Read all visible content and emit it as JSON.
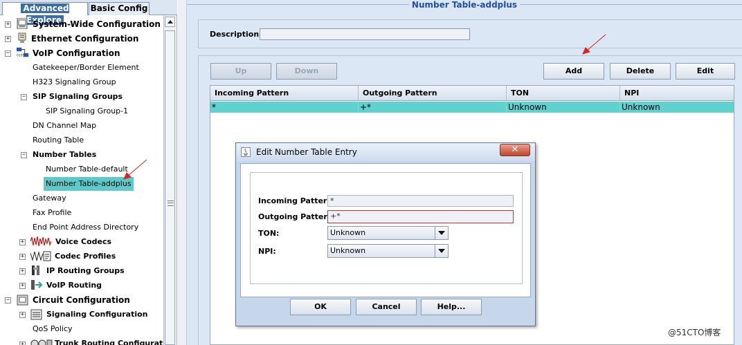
{
  "tabs": {
    "advanced": "Advanced Explore",
    "basic": "Basic Config"
  },
  "tree": {
    "system_wide": "System-Wide Configuration",
    "ethernet": "Ethernet Configuration",
    "voip": "VoIP Configuration",
    "gatekeeper": "Gatekeeper/Border Element",
    "h323": "H323 Signaling Group",
    "sip_groups": "SIP Signaling Groups",
    "sip_group_1": "SIP Signaling Group-1",
    "dn_map": "DN Channel Map",
    "routing_table": "Routing Table",
    "number_tables": "Number Tables",
    "nt_default": "Number Table-default",
    "nt_addplus": "Number Table-addplus",
    "gateway": "Gateway",
    "fax_profile": "Fax Profile",
    "endpoint_dir": "End Point Address Directory",
    "voice_codecs": "Voice Codecs",
    "codec_profiles": "Codec Profiles",
    "ip_routing_groups": "IP Routing Groups",
    "voip_routing": "VoIP Routing",
    "circuit": "Circuit Configuration",
    "signaling": "Signaling Configuration",
    "qos": "QoS Policy",
    "trunk_routing": "Trunk Routing Configuration"
  },
  "panel": {
    "title": "Number Table-addplus",
    "description_label": "Description:",
    "description_value": "",
    "buttons": {
      "up": "Up",
      "down": "Down",
      "add": "Add",
      "delete": "Delete",
      "edit": "Edit"
    }
  },
  "table": {
    "columns": [
      "Incoming Pattern",
      "Outgoing Pattern",
      "TON",
      "NPI"
    ],
    "rows": [
      {
        "incoming": "*",
        "outgoing": "+*",
        "ton": "Unknown",
        "npi": "Unknown"
      }
    ]
  },
  "dialog": {
    "title": "Edit Number Table Entry",
    "close": "✕",
    "incoming_label": "Incoming Pattern",
    "incoming_value": "*",
    "outgoing_label": "Outgoing Pattern",
    "outgoing_value": "+*",
    "ton_label": "TON:",
    "ton_value": "Unknown",
    "npi_label": "NPI:",
    "npi_value": "Unknown",
    "ok": "OK",
    "cancel": "Cancel",
    "help": "Help..."
  },
  "watermark": "@51CTO博客",
  "colors": {
    "selection": "#5fd1cf",
    "panel_bg": "#dbe7f5",
    "title_blue": "#1f4fa8",
    "annotation_red": "#e02020"
  }
}
